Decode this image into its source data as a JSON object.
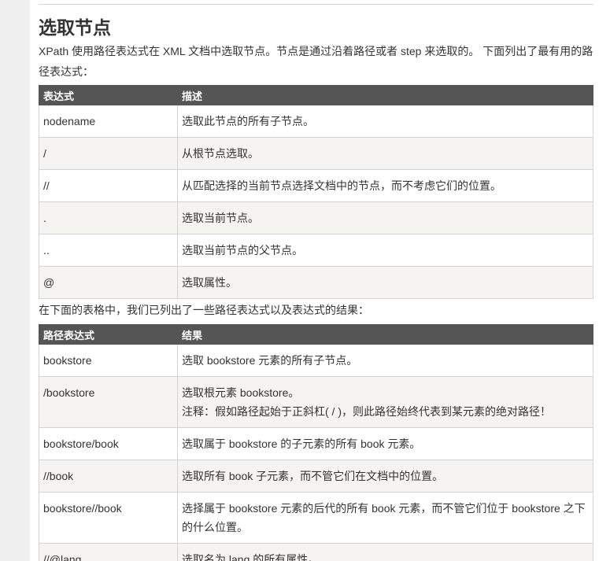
{
  "section": {
    "title": "选取节点",
    "intro": "XPath 使用路径表达式在 XML 文档中选取节点。节点是通过沿着路径或者 step 来选取的。 下面列出了最有用的路径表达式：",
    "between_text": "在下面的表格中，我们已列出了一些路径表达式以及表达式的结果："
  },
  "table1": {
    "headers": [
      "表达式",
      "描述"
    ],
    "rows": [
      {
        "expr": "nodename",
        "desc": "选取此节点的所有子节点。"
      },
      {
        "expr": "/",
        "desc": "从根节点选取。"
      },
      {
        "expr": "//",
        "desc": "从匹配选择的当前节点选择文档中的节点，而不考虑它们的位置。"
      },
      {
        "expr": ".",
        "desc": "选取当前节点。"
      },
      {
        "expr": "..",
        "desc": "选取当前节点的父节点。"
      },
      {
        "expr": "@",
        "desc": "选取属性。"
      }
    ]
  },
  "table2": {
    "headers": [
      "路径表达式",
      "结果"
    ],
    "rows": [
      {
        "expr": "bookstore",
        "result": "选取 bookstore 元素的所有子节点。"
      },
      {
        "expr": "/bookstore",
        "result": "选取根元素 bookstore。",
        "note": "注释：假如路径起始于正斜杠( / )，则此路径始终代表到某元素的绝对路径！"
      },
      {
        "expr": "bookstore/book",
        "result": "选取属于 bookstore 的子元素的所有 book 元素。"
      },
      {
        "expr": "//book",
        "result": "选取所有 book 子元素，而不管它们在文档中的位置。"
      },
      {
        "expr": "bookstore//book",
        "result": "选择属于 bookstore 元素的后代的所有 book 元素，而不管它们位于 bookstore 之下的什么位置。"
      },
      {
        "expr": "//@lang",
        "result": "选取名为 lang 的所有属性。"
      }
    ]
  }
}
